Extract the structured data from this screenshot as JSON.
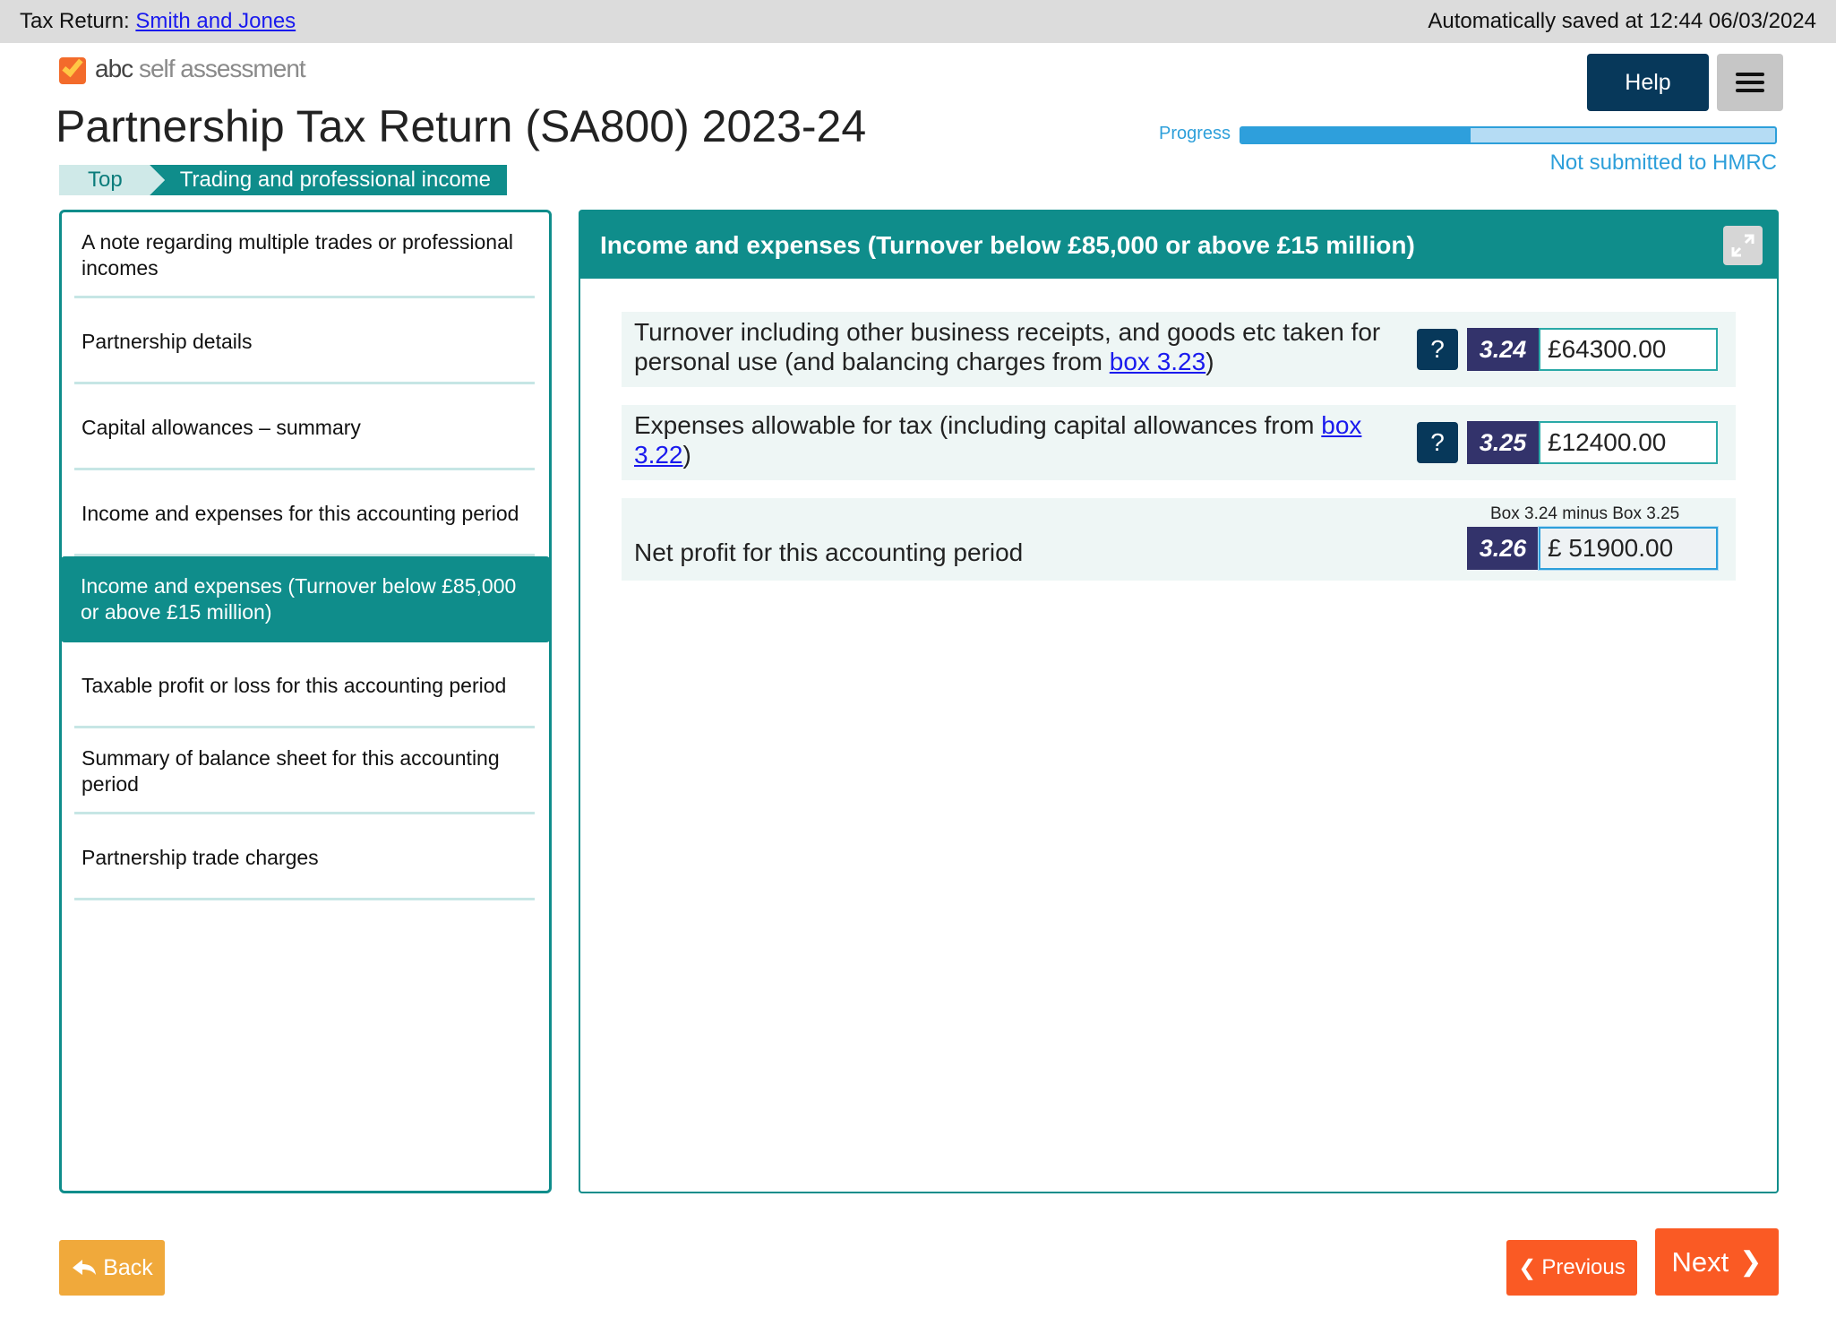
{
  "topbar": {
    "prefix": "Tax Return:",
    "client_link": "Smith and Jones",
    "autosave": "Automatically saved at 12:44 06/03/2024"
  },
  "logo": {
    "brand": "abc",
    "product": "self assessment"
  },
  "page": {
    "title": "Partnership Tax Return (SA800) 2023-24"
  },
  "breadcrumb": {
    "top": "Top",
    "current": "Trading and professional income"
  },
  "header": {
    "help_label": "Help",
    "menu_icon": "hamburger-menu-icon",
    "progress_label": "Progress",
    "progress_fraction": 0.43,
    "submission_status": "Not submitted to HMRC"
  },
  "sidebar": {
    "items": [
      {
        "label": "A note regarding multiple trades or professional incomes",
        "active": false
      },
      {
        "label": "Partnership details",
        "active": false
      },
      {
        "label": "Capital allowances – summary",
        "active": false
      },
      {
        "label": "Income and expenses for this accounting period",
        "active": false
      },
      {
        "label": "Income and expenses (Turnover below £85,000 or above £15 million)",
        "active": true
      },
      {
        "label": "Taxable profit or loss for this accounting period",
        "active": false
      },
      {
        "label": "Summary of balance sheet for this accounting period",
        "active": false
      },
      {
        "label": "Partnership trade charges",
        "active": false
      }
    ]
  },
  "panel": {
    "title": "Income and expenses (Turnover below £85,000 or above £15 million)",
    "expand_icon": "expand-arrows-icon",
    "fields": [
      {
        "label_before": "Turnover including other business receipts, and goods etc taken for personal use (and balancing charges from ",
        "link": "box 3.23",
        "label_after": ")",
        "help": "?",
        "box": "3.24",
        "value": "£64300.00"
      },
      {
        "label_before": "Expenses allowable for tax (including capital allowances from ",
        "link": "box 3.22",
        "label_after": ")",
        "help": "?",
        "box": "3.25",
        "value": "£12400.00"
      },
      {
        "label": "Net profit for this accounting period",
        "note": "Box 3.24 minus Box 3.25",
        "box": "3.26",
        "value": "£ 51900.00"
      }
    ]
  },
  "footer": {
    "back_label": "Back",
    "previous_label": "Previous",
    "next_label": "Next"
  },
  "colors": {
    "teal": "#0f8d8b",
    "navy": "#07385a",
    "box_purple": "#33336b",
    "orange": "#fa5a24",
    "amber": "#f0a93b",
    "progress_blue": "#2d9fda"
  }
}
